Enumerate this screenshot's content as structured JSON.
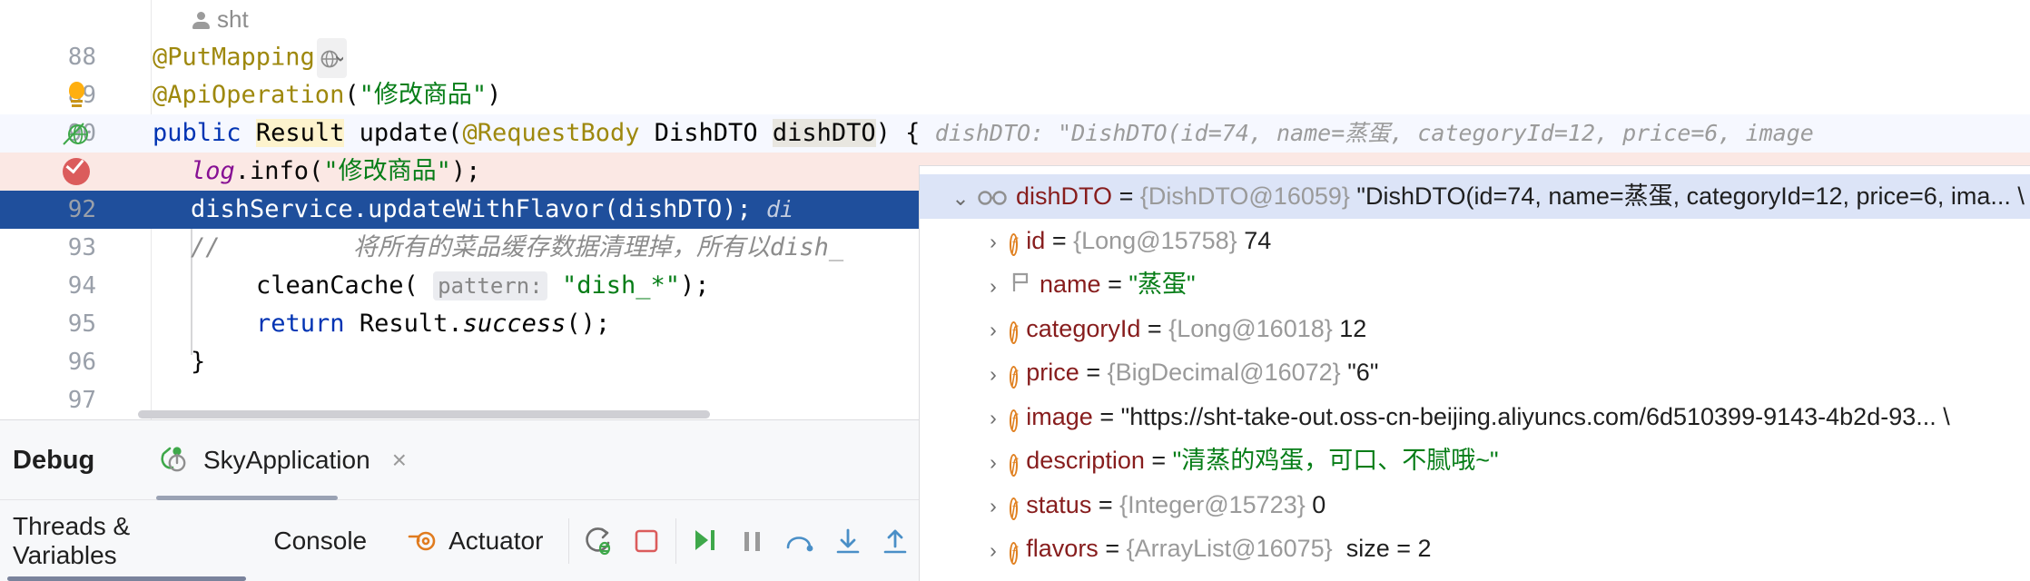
{
  "editor": {
    "author_annotation": "sht",
    "lines": [
      {
        "number": "88",
        "text_parts": [
          {
            "t": "@PutMapping",
            "cls": "anno"
          }
        ],
        "has_globe_badge": true,
        "marker": "none",
        "bg": "none"
      },
      {
        "number": "89",
        "text_parts": [
          {
            "t": "@ApiOperation",
            "cls": "anno"
          },
          {
            "t": "(",
            "cls": "plain"
          },
          {
            "t": "\"修改商品\"",
            "cls": "str"
          },
          {
            "t": ")",
            "cls": "plain"
          }
        ],
        "marker": "bulb",
        "bg": "none"
      },
      {
        "number": "90",
        "marker": "globe",
        "bg": "current"
      },
      {
        "number": "",
        "marker": "breakpoint",
        "bg": "bp"
      },
      {
        "number": "92",
        "marker": "none",
        "bg": "exec"
      },
      {
        "number": "93",
        "marker": "none",
        "bg": "none"
      },
      {
        "number": "94",
        "marker": "none",
        "bg": "none"
      },
      {
        "number": "95",
        "marker": "none",
        "bg": "none"
      },
      {
        "number": "96",
        "marker": "none",
        "bg": "none"
      },
      {
        "number": "97",
        "marker": "none",
        "bg": "none"
      }
    ],
    "line90": {
      "kw_public": "public",
      "type_result": "Result",
      "method": "update",
      "paren_open": "(",
      "anno_requestbody": "@RequestBody",
      "type_dto": "DishDTO",
      "param_name": "dishDTO",
      "paren_close": ")",
      "brace": "{",
      "inline_hint": "dishDTO: \"DishDTO(id=74, name=蒸蛋, categoryId=12, price=6, image"
    },
    "line91": {
      "var_log": "log",
      "dot_info": ".info(",
      "arg": "\"修改商品\"",
      "tail": ");"
    },
    "line92": {
      "call": "dishService.updateWithFlavor(dishDTO);",
      "inline_hint": "di"
    },
    "line93": {
      "slashes": "//",
      "comment": "将所有的菜品缓存数据清理掉，所有以dish_"
    },
    "line94": {
      "method": "cleanCache(",
      "param_label": "pattern:",
      "arg": "\"dish_*\"",
      "tail": ");"
    },
    "line95": {
      "kw_return": "return",
      "type": "Result.",
      "method": "success",
      "tail": "();"
    },
    "line96": {
      "brace": "}"
    }
  },
  "variables_panel": {
    "rows": [
      {
        "indent": 0,
        "arrow": "chevron-down",
        "icon": "glasses-icon",
        "name": "dishDTO",
        "eq": "=",
        "ref": "{DishDTO@16059}",
        "value": "\"DishDTO(id=74, name=蒸蛋, categoryId=12, price=6, ima...",
        "value_tail": "\\",
        "selected": true
      },
      {
        "indent": 1,
        "arrow": "chevron-right",
        "icon": "field-icon",
        "name": "id",
        "eq": "=",
        "ref": "{Long@15758}",
        "value": "74",
        "selected": false
      },
      {
        "indent": 1,
        "arrow": "chevron-right",
        "icon": "flag-icon",
        "name": "name",
        "eq": "=",
        "ref": "",
        "value": "\"蒸蛋\"",
        "value_is_cn_string": true,
        "selected": false
      },
      {
        "indent": 1,
        "arrow": "chevron-right",
        "icon": "field-icon",
        "name": "categoryId",
        "eq": "=",
        "ref": "{Long@16018}",
        "value": "12",
        "selected": false
      },
      {
        "indent": 1,
        "arrow": "chevron-right",
        "icon": "field-icon",
        "name": "price",
        "eq": "=",
        "ref": "{BigDecimal@16072}",
        "value": "\"6\"",
        "selected": false
      },
      {
        "indent": 1,
        "arrow": "chevron-right",
        "icon": "field-icon",
        "name": "image",
        "eq": "=",
        "ref": "",
        "value": "\"https://sht-take-out.oss-cn-beijing.aliyuncs.com/6d510399-9143-4b2d-93...",
        "value_tail": "\\",
        "selected": false
      },
      {
        "indent": 1,
        "arrow": "chevron-right",
        "icon": "field-icon",
        "name": "description",
        "eq": "=",
        "ref": "",
        "value": "\"清蒸的鸡蛋，可口、不腻哦~\"",
        "value_is_cn_string": true,
        "selected": false
      },
      {
        "indent": 1,
        "arrow": "chevron-right",
        "icon": "field-icon",
        "name": "status",
        "eq": "=",
        "ref": "{Integer@15723}",
        "value": "0",
        "selected": false
      },
      {
        "indent": 1,
        "arrow": "chevron-right",
        "icon": "field-icon",
        "name": "flavors",
        "eq": "=",
        "ref": "{ArrayList@16075}",
        "value": "size = 2",
        "selected": false
      }
    ]
  },
  "debug_window": {
    "title": "Debug",
    "session_tab": {
      "label": "SkyApplication",
      "close_label": "×",
      "icon": "debug-session-icon"
    },
    "subtabs": [
      {
        "label": "Threads & Variables",
        "active": true,
        "icon": null
      },
      {
        "label": "Console",
        "active": false,
        "icon": null
      },
      {
        "label": "Actuator",
        "active": false,
        "icon": "actuator-icon"
      }
    ],
    "toolbar_buttons": [
      {
        "name": "rerun-debug-button",
        "icon": "rerun-debug-icon"
      },
      {
        "name": "stop-button",
        "icon": "stop-icon"
      },
      {
        "name": "resume-button",
        "icon": "resume-icon"
      },
      {
        "name": "pause-button",
        "icon": "pause-icon"
      },
      {
        "name": "step-over-button",
        "icon": "step-over-icon"
      },
      {
        "name": "step-into-button",
        "icon": "step-into-icon"
      },
      {
        "name": "step-out-button",
        "icon": "step-out-icon"
      }
    ]
  },
  "colors": {
    "exec_line_bg": "#1f4f9c",
    "breakpoint_line_bg": "#fbe8e4",
    "current_line_bg": "#f6f8ff",
    "selection_bg": "#dce4f7",
    "keyword": "#0033b3",
    "string": "#067d17",
    "annotation": "#9e880d",
    "field": "#871094",
    "comment": "#8c8c8c",
    "accent_orange": "#e08020",
    "accent_green": "#3ea84a",
    "stop_red": "#db5c5c"
  }
}
